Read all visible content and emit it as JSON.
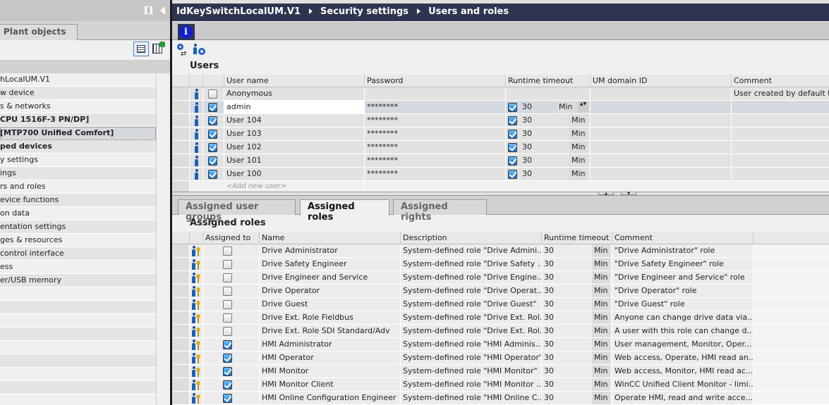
{
  "left": {
    "tab": "Plant objects",
    "tree": [
      {
        "label": "hLocalUM.V1"
      },
      {
        "label": "w device"
      },
      {
        "label": "s & networks"
      },
      {
        "label": "CPU 1516F-3 PN/DP]",
        "bold": true
      },
      {
        "label": "[MTP700 Unified Comfort]",
        "bold": true,
        "selected": true
      },
      {
        "label": "ped devices",
        "bold": true
      },
      {
        "label": "y settings"
      },
      {
        "label": "ings"
      },
      {
        "label": "rs and roles"
      },
      {
        "label": "evice functions"
      },
      {
        "label": "on data"
      },
      {
        "label": "entation settings"
      },
      {
        "label": "ges & resources"
      },
      {
        "label": " control interface"
      },
      {
        "label": "ess"
      },
      {
        "label": "er/USB memory"
      },
      {
        "label": ""
      },
      {
        "label": ""
      },
      {
        "label": ""
      },
      {
        "label": ""
      },
      {
        "label": ""
      },
      {
        "label": ""
      },
      {
        "label": ""
      },
      {
        "label": ""
      }
    ]
  },
  "breadcrumb": [
    "IdKeySwitchLocalUM.V1",
    "Security settings",
    "Users and roles"
  ],
  "info_icon": "i",
  "users": {
    "title": "Users",
    "columns": [
      "User name",
      "Password",
      "Runtime timeout",
      "UM domain ID",
      "Comment"
    ],
    "rows": [
      {
        "name": "Anonymous",
        "checked": false,
        "password": "",
        "timeout_on": null,
        "timeout": "",
        "unit": "",
        "comment": "User created by default t"
      },
      {
        "name": "admin",
        "checked": true,
        "password": "********",
        "timeout_on": true,
        "timeout": "30",
        "unit": "Min",
        "comment": "",
        "selected": true
      },
      {
        "name": "User 104",
        "checked": true,
        "password": "********",
        "timeout_on": true,
        "timeout": "30",
        "unit": "Min",
        "comment": ""
      },
      {
        "name": "User 103",
        "checked": true,
        "password": "********",
        "timeout_on": true,
        "timeout": "30",
        "unit": "Min",
        "comment": ""
      },
      {
        "name": "User 102",
        "checked": true,
        "password": "********",
        "timeout_on": true,
        "timeout": "30",
        "unit": "Min",
        "comment": ""
      },
      {
        "name": "User 101",
        "checked": true,
        "password": "********",
        "timeout_on": true,
        "timeout": "30",
        "unit": "Min",
        "comment": ""
      },
      {
        "name": "User 100",
        "checked": true,
        "password": "********",
        "timeout_on": true,
        "timeout": "30",
        "unit": "Min",
        "comment": ""
      }
    ],
    "add_new": "<Add new user>"
  },
  "tabs": [
    "Assigned user groups",
    "Assigned roles",
    "Assigned rights"
  ],
  "roles": {
    "title": "Assigned roles",
    "columns": [
      "Assigned to",
      "Name",
      "Description",
      "Runtime timeout",
      "Comment"
    ],
    "rows": [
      {
        "checked": false,
        "name": "Drive Administrator",
        "desc": "System-defined role \"Drive Admini...",
        "timeout": "30",
        "unit": "Min",
        "comment": "\"Drive Administrator\" role"
      },
      {
        "checked": false,
        "name": "Drive Safety Engineer",
        "desc": "System-defined role \"Drive Safety ...",
        "timeout": "30",
        "unit": "Min",
        "comment": "\"Drive Safety Engineer\" role"
      },
      {
        "checked": false,
        "name": "Drive Engineer and Service",
        "desc": "System-defined role \"Drive Engine...",
        "timeout": "30",
        "unit": "Min",
        "comment": "\"Drive Engineer and Service\" role"
      },
      {
        "checked": false,
        "name": "Drive Operator",
        "desc": "System-defined role \"Drive Operat...",
        "timeout": "30",
        "unit": "Min",
        "comment": "\"Drive Operator\" role"
      },
      {
        "checked": false,
        "name": "Drive Guest",
        "desc": "System-defined role \"Drive Guest\"",
        "timeout": "30",
        "unit": "Min",
        "comment": "\"Drive Guest\" role"
      },
      {
        "checked": false,
        "name": "Drive Ext. Role Fieldbus",
        "desc": "System-defined role \"Drive Ext. Rol...",
        "timeout": "30",
        "unit": "Min",
        "comment": "Anyone can change drive data via..."
      },
      {
        "checked": false,
        "name": "Drive Ext. Role SDI Standard/Adv",
        "desc": "System-defined role \"Drive Ext. Rol...",
        "timeout": "30",
        "unit": "Min",
        "comment": "A user with this role can change d..."
      },
      {
        "checked": true,
        "name": "HMI Administrator",
        "desc": "System-defined role \"HMI Adminis...",
        "timeout": "30",
        "unit": "Min",
        "comment": "User management, Monitor, Oper..."
      },
      {
        "checked": true,
        "name": "HMI Operator",
        "desc": "System-defined role \"HMI Operator\"",
        "timeout": "30",
        "unit": "Min",
        "comment": "Web access, Operate, HMI read an..."
      },
      {
        "checked": true,
        "name": "HMI Monitor",
        "desc": "System-defined role \"HMI Monitor\"",
        "timeout": "30",
        "unit": "Min",
        "comment": "Web access, Monitor, HMI read ac..."
      },
      {
        "checked": true,
        "name": "HMI Monitor Client",
        "desc": "System-defined role \"HMI Monitor ...",
        "timeout": "30",
        "unit": "Min",
        "comment": "WinCC Unified Client Monitor - limi..."
      },
      {
        "checked": true,
        "name": "HMI Online Configuration Engineer",
        "desc": "System-defined role \"HMI Online C...",
        "timeout": "30",
        "unit": "Min",
        "comment": "Operate HMI, read and write acce..."
      }
    ]
  },
  "colors": {
    "breadcrumb_bg": "#2d3550",
    "check_blue": "#1a70c8"
  }
}
